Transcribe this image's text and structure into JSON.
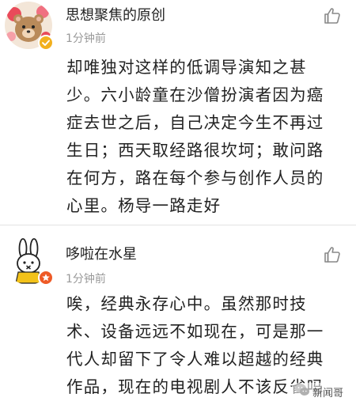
{
  "comments": [
    {
      "username": "思想聚焦的原创",
      "time": "1分钟前",
      "lines": [
        "却唯独对这样的低调导演知之甚",
        "少。六小龄童在沙僧扮演者因为癌",
        "症去世之后，自己决定今生不再过",
        "生日；西天取经路很坎坷；敢问路",
        "在何方，路在每个参与创作人员的",
        "心里。杨导一路走好"
      ],
      "avatar_icon": "cartoon-bear-avatar-icon",
      "badge_icon": "verified-badge-icon",
      "badge_color": "#f2b01e"
    },
    {
      "username": "哆啦在水星",
      "time": "1分钟前",
      "lines": [
        "唉，经典永存心中。虽然那时技",
        "术、设备远远不如现在，可是那一",
        "代人却留下了令人难以超越的经典",
        "作品，现在的电视剧人不该反省吗"
      ],
      "avatar_icon": "miffy-rabbit-avatar-icon",
      "badge_icon": "member-badge-icon",
      "badge_color": "#ee5a26"
    }
  ],
  "like_icon": "thumbs-up-icon",
  "watermark": {
    "icon": "wechat-logo-icon",
    "text": "新闻哥"
  }
}
